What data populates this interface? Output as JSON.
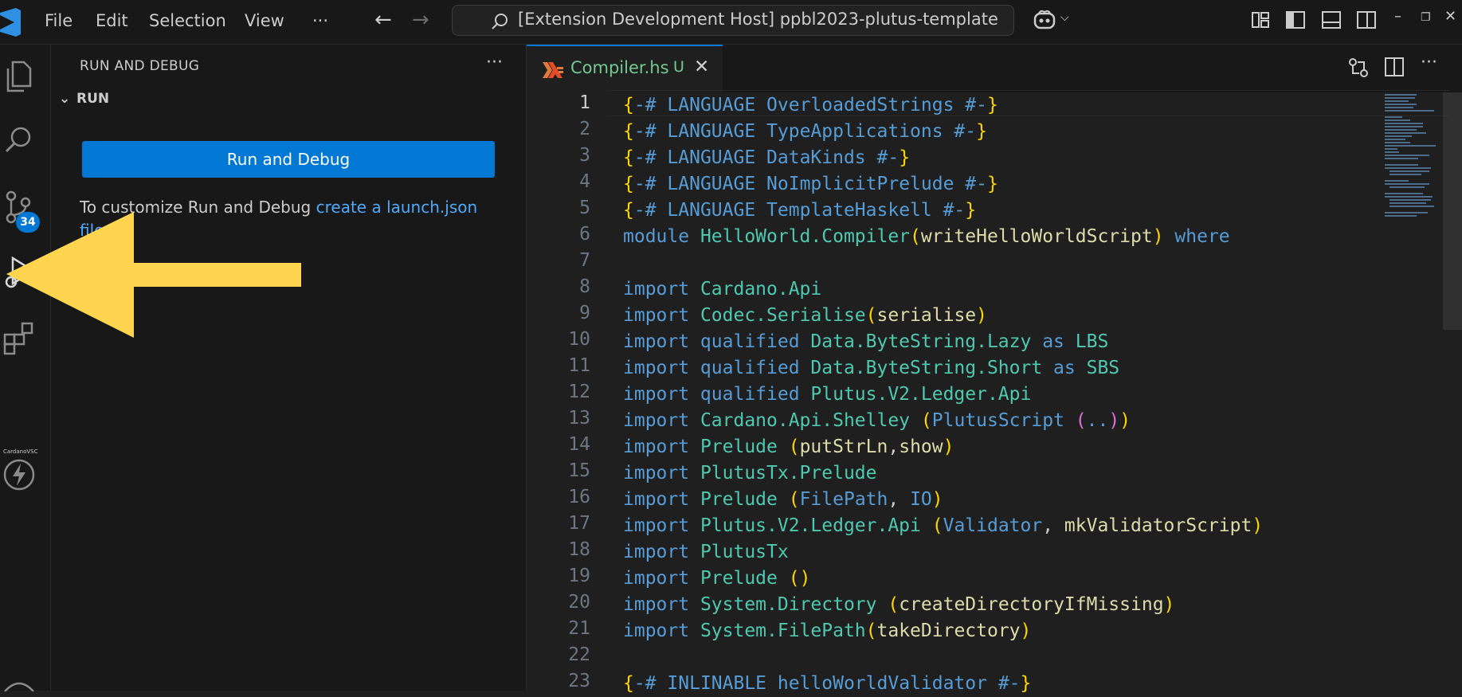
{
  "titlebar": {
    "menu": [
      "File",
      "Edit",
      "Selection",
      "View"
    ],
    "more": "···",
    "command_center": "[Extension Development Host] ppbl2023-plutus-template"
  },
  "activitybar": {
    "source_control_badge": "34",
    "cardano_label": "CardanoVSC"
  },
  "sidebar": {
    "title": "RUN AND DEBUG",
    "section": "RUN",
    "run_button": "Run and Debug",
    "hint_text": "To customize Run and Debug ",
    "hint_link": "create a launch.json file."
  },
  "editor": {
    "tab": {
      "name": "Compiler.hs",
      "status": "U"
    },
    "active_line": 1,
    "lines": [
      [
        [
          "c-br",
          "{"
        ],
        [
          "c-kw",
          "-# LANGUAGE OverloadedStrings #-"
        ],
        [
          "c-br",
          "}"
        ]
      ],
      [
        [
          "c-br",
          "{"
        ],
        [
          "c-kw",
          "-# LANGUAGE TypeApplications #-"
        ],
        [
          "c-br",
          "}"
        ]
      ],
      [
        [
          "c-br",
          "{"
        ],
        [
          "c-kw",
          "-# LANGUAGE DataKinds #-"
        ],
        [
          "c-br",
          "}"
        ]
      ],
      [
        [
          "c-br",
          "{"
        ],
        [
          "c-kw",
          "-# LANGUAGE NoImplicitPrelude #-"
        ],
        [
          "c-br",
          "}"
        ]
      ],
      [
        [
          "c-br",
          "{"
        ],
        [
          "c-kw",
          "-# LANGUAGE TemplateHaskell #-"
        ],
        [
          "c-br",
          "}"
        ]
      ],
      [
        [
          "c-kw",
          "module "
        ],
        [
          "c-mod",
          "HelloWorld.Compiler"
        ],
        [
          "c-br",
          "("
        ],
        [
          "c-fn",
          "writeHelloWorldScript"
        ],
        [
          "c-br",
          ")"
        ],
        [
          "c-kw",
          " where"
        ]
      ],
      [],
      [
        [
          "c-kw",
          "import "
        ],
        [
          "c-mod",
          "Cardano.Api"
        ]
      ],
      [
        [
          "c-kw",
          "import "
        ],
        [
          "c-mod",
          "Codec.Serialise"
        ],
        [
          "c-br",
          "("
        ],
        [
          "c-fn",
          "serialise"
        ],
        [
          "c-br",
          ")"
        ]
      ],
      [
        [
          "c-kw",
          "import qualified "
        ],
        [
          "c-mod",
          "Data.ByteString.Lazy"
        ],
        [
          "c-kw",
          " as "
        ],
        [
          "c-mod",
          "LBS"
        ]
      ],
      [
        [
          "c-kw",
          "import qualified "
        ],
        [
          "c-mod",
          "Data.ByteString.Short"
        ],
        [
          "c-kw",
          " as "
        ],
        [
          "c-mod",
          "SBS"
        ]
      ],
      [
        [
          "c-kw",
          "import qualified "
        ],
        [
          "c-mod",
          "Plutus.V2.Ledger.Api"
        ]
      ],
      [
        [
          "c-kw",
          "import "
        ],
        [
          "c-mod",
          "Cardano.Api.Shelley "
        ],
        [
          "c-br",
          "("
        ],
        [
          "c-kw",
          "PlutusScript "
        ],
        [
          "c-br2",
          "("
        ],
        [
          "c-kw",
          ".."
        ],
        [
          "c-br2",
          ")"
        ],
        [
          "c-br",
          ")"
        ]
      ],
      [
        [
          "c-kw",
          "import "
        ],
        [
          "c-mod",
          "Prelude "
        ],
        [
          "c-br",
          "("
        ],
        [
          "c-fn",
          "putStrLn"
        ],
        [
          "c-plain",
          ","
        ],
        [
          "c-fn",
          "show"
        ],
        [
          "c-br",
          ")"
        ]
      ],
      [
        [
          "c-kw",
          "import "
        ],
        [
          "c-mod",
          "PlutusTx.Prelude"
        ]
      ],
      [
        [
          "c-kw",
          "import "
        ],
        [
          "c-mod",
          "Prelude "
        ],
        [
          "c-br",
          "("
        ],
        [
          "c-kw",
          "FilePath"
        ],
        [
          "c-plain",
          ", "
        ],
        [
          "c-kw",
          "IO"
        ],
        [
          "c-br",
          ")"
        ]
      ],
      [
        [
          "c-kw",
          "import "
        ],
        [
          "c-mod",
          "Plutus.V2.Ledger.Api "
        ],
        [
          "c-br",
          "("
        ],
        [
          "c-kw",
          "Validator"
        ],
        [
          "c-plain",
          ", "
        ],
        [
          "c-fn",
          "mkValidatorScript"
        ],
        [
          "c-br",
          ")"
        ]
      ],
      [
        [
          "c-kw",
          "import "
        ],
        [
          "c-mod",
          "PlutusTx"
        ]
      ],
      [
        [
          "c-kw",
          "import "
        ],
        [
          "c-mod",
          "Prelude "
        ],
        [
          "c-br",
          "()"
        ]
      ],
      [
        [
          "c-kw",
          "import "
        ],
        [
          "c-mod",
          "System.Directory "
        ],
        [
          "c-br",
          "("
        ],
        [
          "c-fn",
          "createDirectoryIfMissing"
        ],
        [
          "c-br",
          ")"
        ]
      ],
      [
        [
          "c-kw",
          "import "
        ],
        [
          "c-mod",
          "System.FilePath"
        ],
        [
          "c-br",
          "("
        ],
        [
          "c-fn",
          "takeDirectory"
        ],
        [
          "c-br",
          ")"
        ]
      ],
      [],
      [
        [
          "c-br",
          "{"
        ],
        [
          "c-kw",
          "-# INLINABLE helloWorldValidator #-"
        ],
        [
          "c-br",
          "}"
        ]
      ]
    ]
  },
  "colors": {
    "accent": "#0078d4",
    "tab_untracked": "#73c991",
    "arrow": "#ffd54f"
  }
}
